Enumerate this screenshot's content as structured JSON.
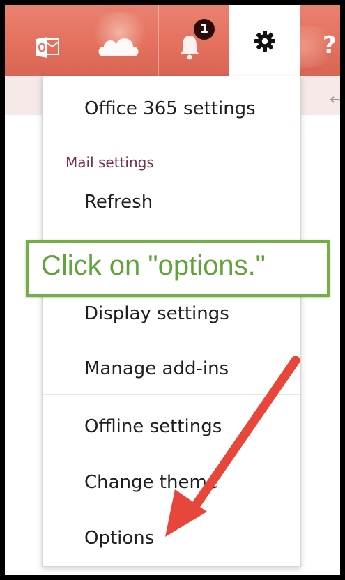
{
  "header": {
    "notification_count": "1",
    "help_glyph": "?",
    "icons": [
      "outlook-icon",
      "onedrive-cloud-icon",
      "bell-icon",
      "gear-icon",
      "help-icon",
      "undo-icon"
    ]
  },
  "menu": {
    "office_settings": "Office 365 settings",
    "section_label": "Mail settings",
    "items": [
      "Refresh",
      "Display settings",
      "Manage add-ins",
      "Offline settings",
      "Change theme",
      "Options"
    ]
  },
  "callout": {
    "text": "Click on \"options.\""
  },
  "colors": {
    "topbar": "#e36f5c",
    "callout_border": "#72b043",
    "callout_text": "#5fa33a",
    "arrow": "#e8463a",
    "section_label": "#7a2d4e"
  }
}
